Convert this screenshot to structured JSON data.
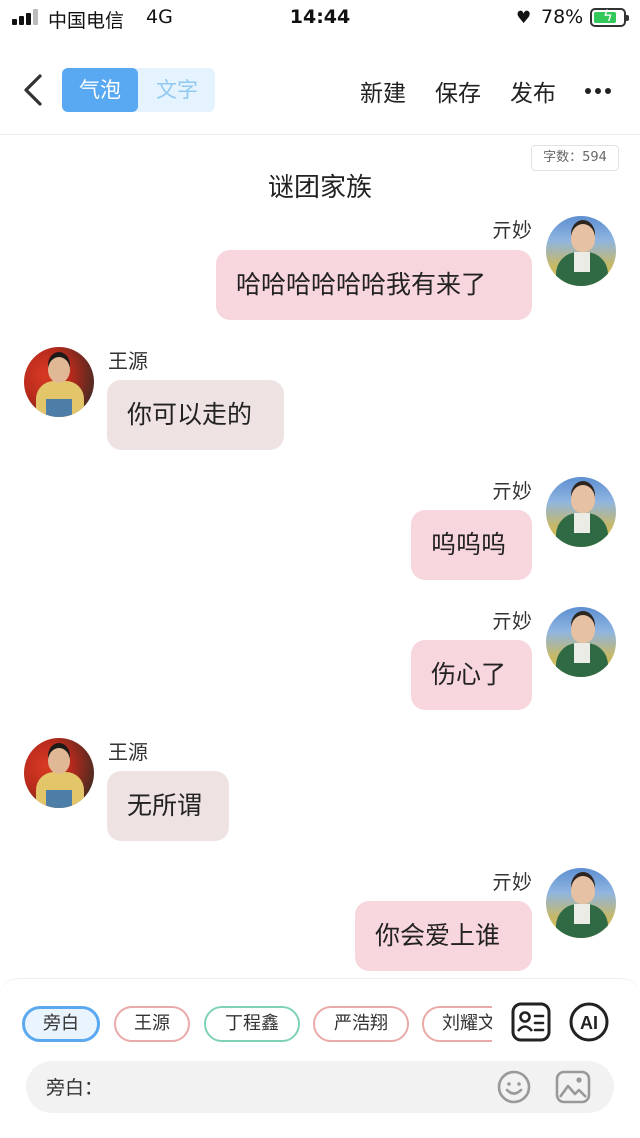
{
  "status_bar": {
    "carrier": "中国电信",
    "network": "4G",
    "time": "14:44",
    "battery_percent": "78%",
    "battery_level": 0.78
  },
  "nav": {
    "tab_bubble": "气泡",
    "tab_text": "文字",
    "new_label": "新建",
    "save_label": "保存",
    "publish_label": "发布"
  },
  "content": {
    "word_count": "字数：594",
    "title": "谜团家族"
  },
  "messages": [
    {
      "side": "right",
      "speaker": "亓妙",
      "text": "哈哈哈哈哈哈我有来了"
    },
    {
      "side": "left",
      "speaker": "王源",
      "text": "你可以走的"
    },
    {
      "side": "right",
      "speaker": "亓妙",
      "text": "呜呜呜"
    },
    {
      "side": "right",
      "speaker": "亓妙",
      "text": "伤心了"
    },
    {
      "side": "left",
      "speaker": "王源",
      "text": "无所谓"
    },
    {
      "side": "right",
      "speaker": "亓妙",
      "text": "你会爱上谁"
    }
  ],
  "roles": [
    "旁白",
    "王源",
    "丁程鑫",
    "严浩翔",
    "刘耀文"
  ],
  "input": {
    "label": "旁白：",
    "value": ""
  },
  "ai_label": "AI",
  "colors": {
    "accent_blue": "#58a8f2",
    "bubble_right": "#f8d6de",
    "bubble_left": "#efe2e2"
  }
}
